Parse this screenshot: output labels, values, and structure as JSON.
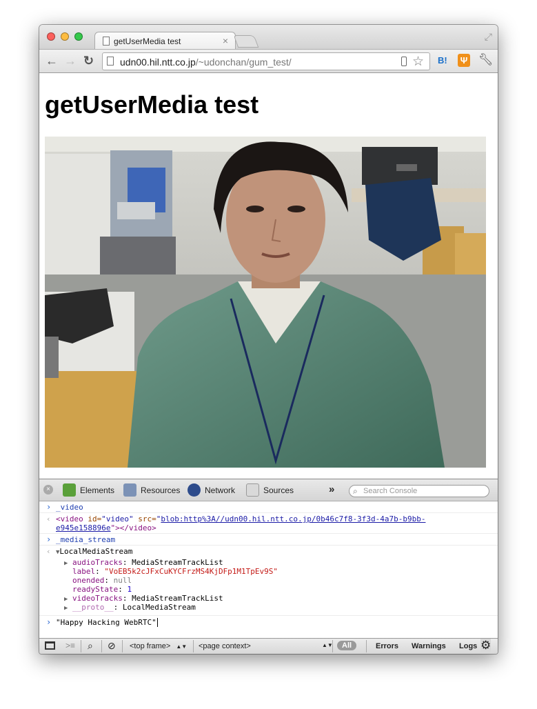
{
  "window": {
    "tab_title": "getUserMedia test"
  },
  "toolbar": {
    "url_host": "udn00.hil.ntt.co.jp",
    "url_path": "/~udonchan/gum_test/",
    "hatena_label": "B!"
  },
  "page": {
    "heading": "getUserMedia test"
  },
  "devtools": {
    "tabs": [
      "Elements",
      "Resources",
      "Network",
      "Sources"
    ],
    "more": "»",
    "search_placeholder": "Search Console"
  },
  "console": {
    "cmd1": "_video",
    "video_tag_open": "<video",
    "video_id_attr": " id=",
    "video_id_val": "\"video\"",
    "video_src_attr": " src=",
    "video_src_q": "\"",
    "video_src_line1": "blob:http%3A//udn00.hil.ntt.co.jp/0b46c7f8-3f3d-4a7b-b9bb-",
    "video_src_line2": "e945e158896e",
    "video_tag_close": "\"></video>",
    "cmd2": "_media_stream",
    "obj_name": "LocalMediaStream",
    "props": [
      {
        "key": "audioTracks",
        "value": "MediaStreamTrackList"
      },
      {
        "key": "label",
        "value": "\"VoEB5k2cJFxCuKYCFrzMS4KjDFp1M1TpEv9S\""
      },
      {
        "key": "onended",
        "value": "null"
      },
      {
        "key": "readyState",
        "value": "1"
      },
      {
        "key": "videoTracks",
        "value": "MediaStreamTrackList"
      },
      {
        "key": "__proto__",
        "value": "LocalMediaStream"
      }
    ],
    "input": "\"Happy Hacking WebRTC\""
  },
  "statusbar": {
    "frame": "<top frame>",
    "context": "<page context>",
    "filters": [
      "All",
      "Errors",
      "Warnings",
      "Logs"
    ]
  }
}
